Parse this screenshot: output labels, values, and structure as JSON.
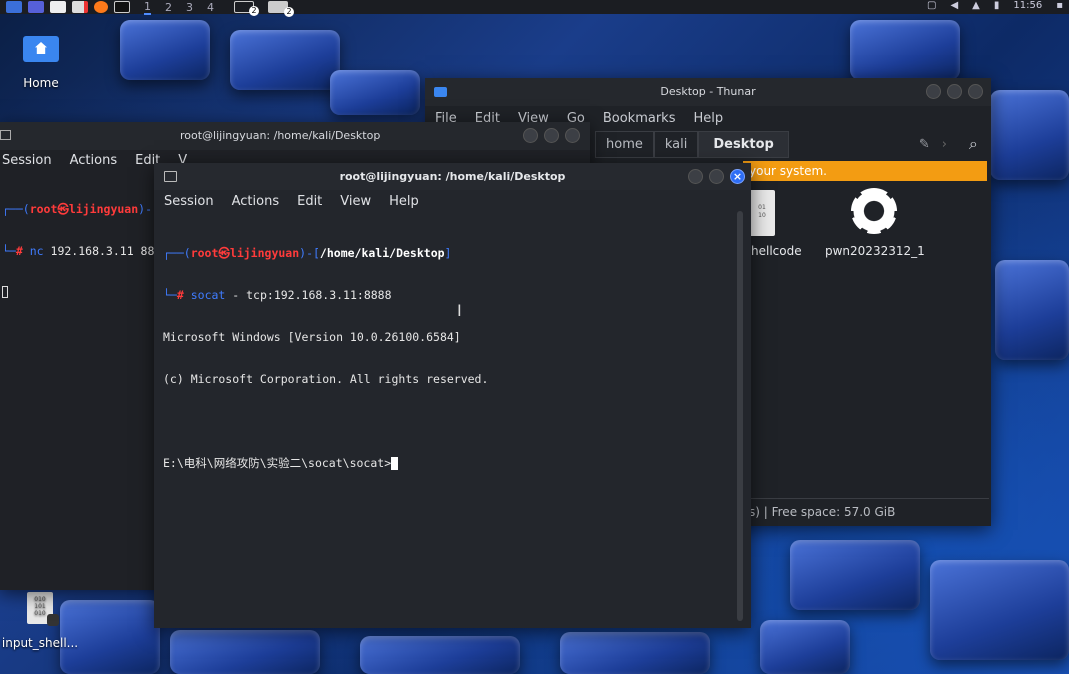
{
  "top_panel": {
    "workspaces": [
      "1",
      "2",
      "3",
      "4"
    ],
    "task_badges": [
      "2",
      "2"
    ],
    "clock": "11:56"
  },
  "desktop": {
    "home_label": "Home",
    "file_label": "input_shell..."
  },
  "thunar": {
    "title": "Desktop - Thunar",
    "menu": [
      "File",
      "Edit",
      "View",
      "Go",
      "Bookmarks",
      "Help"
    ],
    "path": [
      "home",
      "kali",
      "Desktop"
    ],
    "warning": "your system.",
    "files": [
      {
        "name": "hellcode"
      },
      {
        "name": "pwn20232312_1"
      }
    ],
    "status": "s) | Free space: 57.0 GiB"
  },
  "back_terminal": {
    "title": "root@lijingyuan: /home/kali/Desktop",
    "menu": [
      "Session",
      "Actions",
      "Edit",
      "V"
    ],
    "prompt_user": "root㉿lijingyuan",
    "command": "nc",
    "args": "192.168.3.11 88"
  },
  "front_terminal": {
    "title": "root@lijingyuan: /home/kali/Desktop",
    "menu": [
      "Session",
      "Actions",
      "Edit",
      "View",
      "Help"
    ],
    "prompt_user": "root㉿lijingyuan",
    "prompt_path": "/home/kali/Desktop",
    "command": "socat",
    "args": " - tcp:192.168.3.11:8888",
    "output": [
      "Microsoft Windows [Version 10.0.26100.6584]",
      "(c) Microsoft Corporation. All rights reserved.",
      "",
      "E:\\电科\\网络攻防\\实验二\\socat\\socat>"
    ]
  }
}
